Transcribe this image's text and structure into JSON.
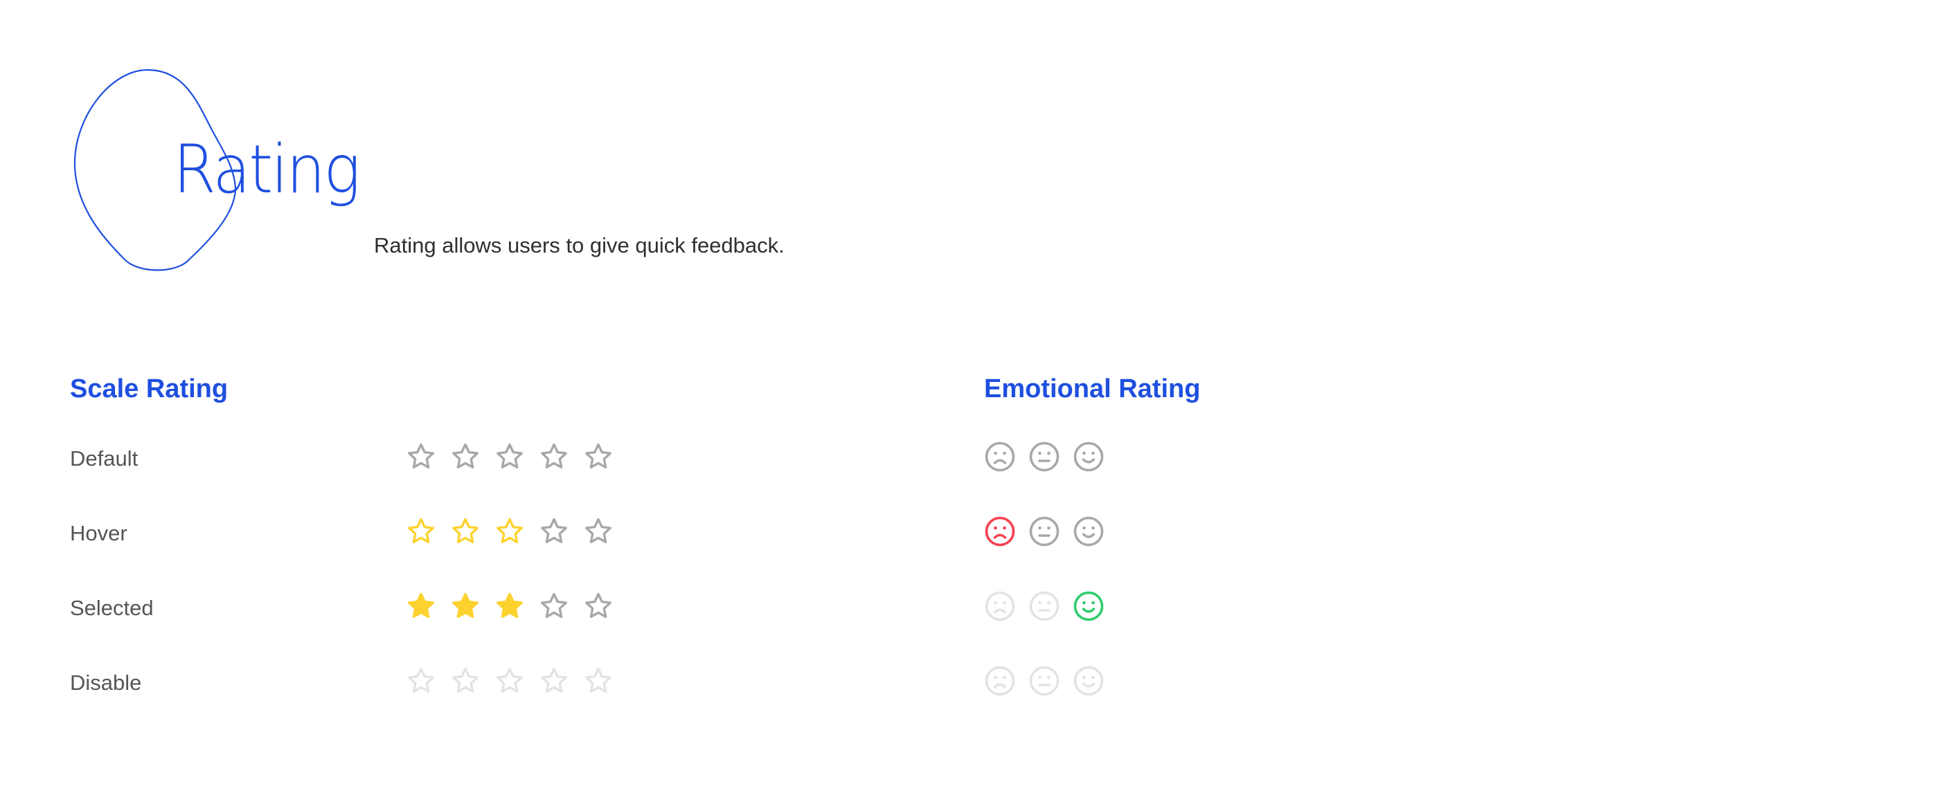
{
  "header": {
    "title": "Rating",
    "description": "Rating allows users to give quick feedback."
  },
  "colors": {
    "accent": "#1e4fdf",
    "label": "#555555",
    "star_default": "#a8a8a8",
    "star_active": "#fdd22f",
    "star_disabled": "#e3e3e3",
    "face_default": "#a8a8a8",
    "face_disabled": "#e3e3e3",
    "face_negative": "#f4404f",
    "face_positive": "#2ecc6b"
  },
  "scale_rating": {
    "heading": "Scale Rating",
    "max_stars": 5,
    "rows": [
      {
        "label": "Default",
        "state": "default",
        "value": 0
      },
      {
        "label": "Hover",
        "state": "hover",
        "value": 3
      },
      {
        "label": "Selected",
        "state": "selected",
        "value": 3
      },
      {
        "label": "Disable",
        "state": "disabled",
        "value": 0
      }
    ]
  },
  "emotional_rating": {
    "heading": "Emotional Rating",
    "faces": [
      "sad",
      "neutral",
      "happy"
    ],
    "rows": [
      {
        "state": "default",
        "active": null
      },
      {
        "state": "hover",
        "active": "sad"
      },
      {
        "state": "selected",
        "active": "happy"
      },
      {
        "state": "disabled",
        "active": null
      }
    ]
  }
}
